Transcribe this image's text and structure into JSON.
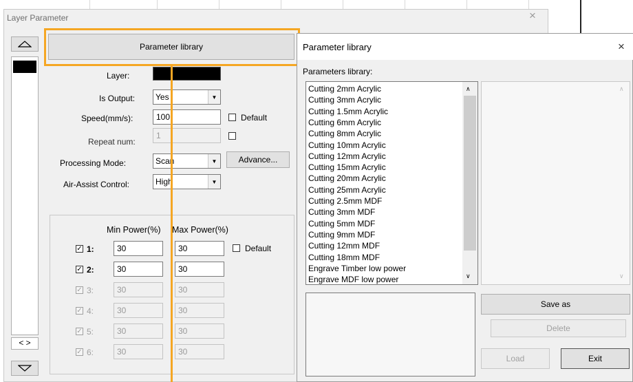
{
  "layer_parameter": {
    "title": "Layer Parameter",
    "close_glyph": "×",
    "parameter_library_button": "Parameter library",
    "layer_label": "Layer:",
    "is_output_label": "Is Output:",
    "is_output_value": "Yes",
    "speed_label": "Speed(mm/s):",
    "speed_value": "100",
    "speed_default_label": "Default",
    "repeat_label": "Repeat num:",
    "repeat_value": "1",
    "processing_mode_label": "Processing Mode:",
    "processing_mode_value": "Scan",
    "advance_button": "Advance...",
    "air_assist_label": "Air-Assist Control:",
    "air_assist_value": "High",
    "min_power_header": "Min Power(%)",
    "max_power_header": "Max Power(%)",
    "power_default_label": "Default",
    "power_rows": [
      {
        "label": "1:",
        "checked": true,
        "enabled": true,
        "min": "30",
        "max": "30"
      },
      {
        "label": "2:",
        "checked": true,
        "enabled": true,
        "min": "30",
        "max": "30"
      },
      {
        "label": "3:",
        "checked": true,
        "enabled": false,
        "min": "30",
        "max": "30"
      },
      {
        "label": "4:",
        "checked": true,
        "enabled": false,
        "min": "30",
        "max": "30"
      },
      {
        "label": "5:",
        "checked": true,
        "enabled": false,
        "min": "30",
        "max": "30"
      },
      {
        "label": "6:",
        "checked": true,
        "enabled": false,
        "min": "30",
        "max": "30"
      }
    ],
    "layer_list_nav": "< >",
    "layer_color": "#000000"
  },
  "parameter_library": {
    "title": "Parameter library",
    "close_glyph": "×",
    "list_label": "Parameters library:",
    "items": [
      "Cutting 2mm Acrylic",
      "Cutting 3mm Acrylic",
      "Cutting 1.5mm Acrylic",
      "Cutting 6mm Acrylic",
      "Cutting 8mm Acrylic",
      "Cutting 10mm Acrylic",
      "Cutting 12mm Acrylic",
      "Cutting 15mm Acrylic",
      "Cutting 20mm Acrylic",
      "Cutting 25mm Acrylic",
      "Cutting 2.5mm MDF",
      "Cutting 3mm MDF",
      "Cutting 5mm MDF",
      "Cutting 9mm MDF",
      "Cutting 12mm MDF",
      "Cutting 18mm MDF",
      "Engrave Timber low power",
      "Engrave MDF low power"
    ],
    "save_as_button": "Save as",
    "delete_button": "Delete",
    "load_button": "Load",
    "exit_button": "Exit"
  },
  "colors": {
    "highlight": "#f5a623"
  }
}
